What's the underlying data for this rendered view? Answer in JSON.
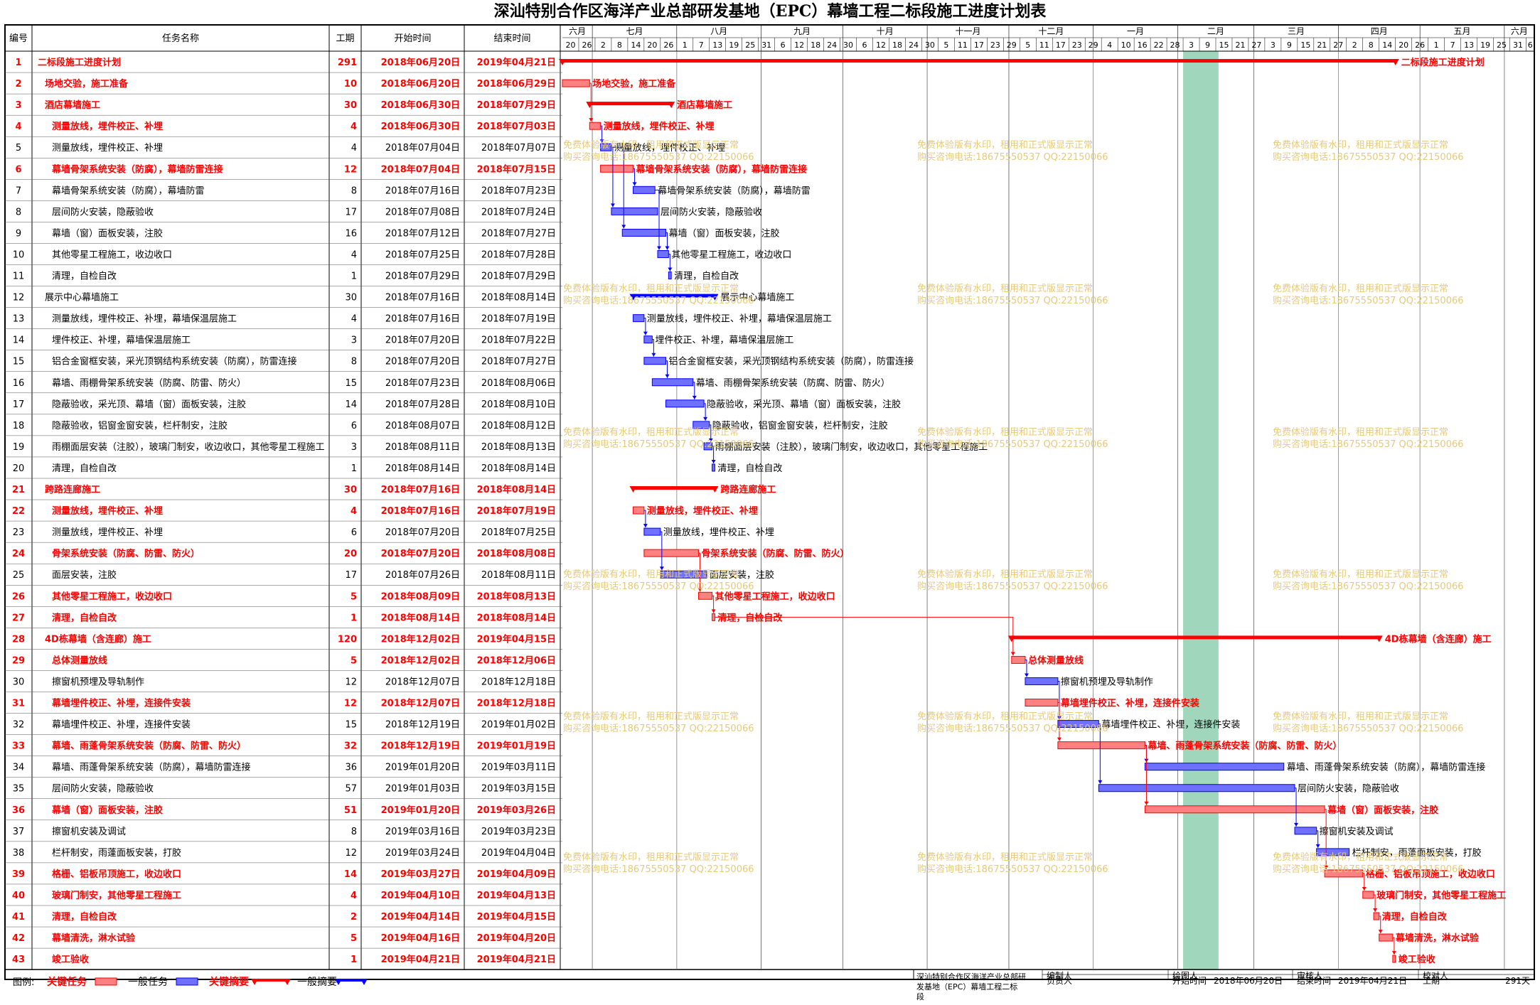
{
  "title": "深汕特别合作区海洋产业总部研发基地（EPC）幕墙工程二标段施工进度计划表",
  "columns": {
    "no": "编号",
    "name": "任务名称",
    "duration": "工期",
    "start": "开始时间",
    "end": "结束时间"
  },
  "months": [
    "六月",
    "七月",
    "八月",
    "九月",
    "十月",
    "十一月",
    "十二月",
    "一月",
    "二月",
    "三月",
    "四月",
    "五月",
    "六月"
  ],
  "day_ticks": [
    "20",
    "26",
    "2",
    "8",
    "14",
    "20",
    "26",
    "1",
    "7",
    "13",
    "19",
    "25",
    "31",
    "6",
    "12",
    "18",
    "24",
    "30",
    "6",
    "12",
    "18",
    "24",
    "30",
    "5",
    "11",
    "17",
    "23",
    "29",
    "5",
    "11",
    "17",
    "23",
    "29",
    "4",
    "10",
    "16",
    "22",
    "28",
    "3",
    "9",
    "15",
    "21",
    "27",
    "3",
    "9",
    "15",
    "21",
    "27",
    "2",
    "8",
    "14",
    "20",
    "26",
    "1",
    "7",
    "13",
    "19",
    "25",
    "31",
    "6",
    "12",
    "18",
    "24",
    "30",
    "5",
    "11",
    "17",
    "23",
    "29",
    "4",
    "10",
    "16",
    "22",
    "28",
    "4",
    "10",
    "16",
    "22",
    "28",
    "3",
    "9",
    "15",
    "21",
    "27",
    "3",
    "9",
    "15",
    "21",
    "27",
    "2",
    "8",
    "14",
    "20",
    "26",
    "1",
    "7",
    "13",
    "19",
    "25",
    "31",
    "6",
    "12",
    "18",
    "24",
    "30",
    "5",
    "11",
    "17",
    "23",
    "29",
    "4",
    "10",
    "16",
    "22",
    "28",
    "3",
    "9",
    "15",
    "21",
    "27",
    "3",
    "9"
  ],
  "chart_data": {
    "type": "gantt",
    "timeline_start": "2018-06-20",
    "timeline_end": "2019-06-12",
    "shaded_period": [
      "2019-02-03",
      "2019-02-16"
    ],
    "tasks": [
      {
        "id": "1",
        "name": "二标段施工进度计划",
        "dur": "291",
        "start": "2018年06月20日",
        "end": "2019年04月21日",
        "kind": "sum",
        "critical": true,
        "s": "2018-06-20",
        "e": "2019-04-21",
        "indent": 0
      },
      {
        "id": "2",
        "name": "场地交验，施工准备",
        "dur": "10",
        "start": "2018年06月20日",
        "end": "2018年06月29日",
        "kind": "task",
        "critical": true,
        "s": "2018-06-20",
        "e": "2018-06-29",
        "indent": 1
      },
      {
        "id": "3",
        "name": "酒店幕墙施工",
        "dur": "30",
        "start": "2018年06月30日",
        "end": "2018年07月29日",
        "kind": "sum",
        "critical": true,
        "s": "2018-06-30",
        "e": "2018-07-29",
        "indent": 1
      },
      {
        "id": "4",
        "name": "测量放线，埋件校正、补埋",
        "dur": "4",
        "start": "2018年06月30日",
        "end": "2018年07月03日",
        "kind": "task",
        "critical": true,
        "s": "2018-06-30",
        "e": "2018-07-03",
        "indent": 2
      },
      {
        "id": "5",
        "name": "测量放线，埋件校正、补埋",
        "dur": "4",
        "start": "2018年07月04日",
        "end": "2018年07月07日",
        "kind": "task",
        "critical": false,
        "s": "2018-07-04",
        "e": "2018-07-07",
        "indent": 2
      },
      {
        "id": "6",
        "name": "幕墙骨架系统安装（防腐），幕墙防雷连接",
        "dur": "12",
        "start": "2018年07月04日",
        "end": "2018年07月15日",
        "kind": "task",
        "critical": true,
        "s": "2018-07-04",
        "e": "2018-07-15",
        "indent": 2
      },
      {
        "id": "7",
        "name": "幕墙骨架系统安装（防腐），幕墙防雷",
        "dur": "8",
        "start": "2018年07月16日",
        "end": "2018年07月23日",
        "kind": "task",
        "critical": false,
        "s": "2018-07-16",
        "e": "2018-07-23",
        "indent": 2
      },
      {
        "id": "8",
        "name": "层间防火安装，隐蔽验收",
        "dur": "17",
        "start": "2018年07月08日",
        "end": "2018年07月24日",
        "kind": "task",
        "critical": false,
        "s": "2018-07-08",
        "e": "2018-07-24",
        "indent": 2
      },
      {
        "id": "9",
        "name": "幕墙（窗）面板安装，注胶",
        "dur": "16",
        "start": "2018年07月12日",
        "end": "2018年07月27日",
        "kind": "task",
        "critical": false,
        "s": "2018-07-12",
        "e": "2018-07-27",
        "indent": 2
      },
      {
        "id": "10",
        "name": "其他零星工程施工，收边收口",
        "dur": "4",
        "start": "2018年07月25日",
        "end": "2018年07月28日",
        "kind": "task",
        "critical": false,
        "s": "2018-07-25",
        "e": "2018-07-28",
        "indent": 2
      },
      {
        "id": "11",
        "name": "清理，自检自改",
        "dur": "1",
        "start": "2018年07月29日",
        "end": "2018年07月29日",
        "kind": "task",
        "critical": false,
        "s": "2018-07-29",
        "e": "2018-07-29",
        "indent": 2
      },
      {
        "id": "12",
        "name": "展示中心幕墙施工",
        "dur": "30",
        "start": "2018年07月16日",
        "end": "2018年08月14日",
        "kind": "sum",
        "critical": false,
        "s": "2018-07-16",
        "e": "2018-08-14",
        "indent": 1
      },
      {
        "id": "13",
        "name": "测量放线，埋件校正、补埋，幕墙保温层施工",
        "dur": "4",
        "start": "2018年07月16日",
        "end": "2018年07月19日",
        "kind": "task",
        "critical": false,
        "s": "2018-07-16",
        "e": "2018-07-19",
        "indent": 2
      },
      {
        "id": "14",
        "name": "埋件校正、补埋，幕墙保温层施工",
        "dur": "3",
        "start": "2018年07月20日",
        "end": "2018年07月22日",
        "kind": "task",
        "critical": false,
        "s": "2018-07-20",
        "e": "2018-07-22",
        "indent": 2
      },
      {
        "id": "15",
        "name": "铝合金窗框安装，采光顶钢结构系统安装（防腐），防雷连接",
        "dur": "8",
        "start": "2018年07月20日",
        "end": "2018年07月27日",
        "kind": "task",
        "critical": false,
        "s": "2018-07-20",
        "e": "2018-07-27",
        "indent": 2
      },
      {
        "id": "16",
        "name": "幕墙、雨棚骨架系统安装（防腐、防雷、防火）",
        "dur": "15",
        "start": "2018年07月23日",
        "end": "2018年08月06日",
        "kind": "task",
        "critical": false,
        "s": "2018-07-23",
        "e": "2018-08-06",
        "indent": 2
      },
      {
        "id": "17",
        "name": "隐蔽验收，采光顶、幕墙（窗）面板安装，注胶",
        "dur": "14",
        "start": "2018年07月28日",
        "end": "2018年08月10日",
        "kind": "task",
        "critical": false,
        "s": "2018-07-28",
        "e": "2018-08-10",
        "indent": 2
      },
      {
        "id": "18",
        "name": "隐蔽验收，铝窗金窗安装，栏杆制安，注胶",
        "dur": "6",
        "start": "2018年08月07日",
        "end": "2018年08月12日",
        "kind": "task",
        "critical": false,
        "s": "2018-08-07",
        "e": "2018-08-12",
        "indent": 2
      },
      {
        "id": "19",
        "name": "雨棚面层安装（注胶），玻璃门制安，收边收口，其他零星工程施工",
        "dur": "3",
        "start": "2018年08月11日",
        "end": "2018年08月13日",
        "kind": "task",
        "critical": false,
        "s": "2018-08-11",
        "e": "2018-08-13",
        "indent": 2
      },
      {
        "id": "20",
        "name": "清理，自检自改",
        "dur": "1",
        "start": "2018年08月14日",
        "end": "2018年08月14日",
        "kind": "task",
        "critical": false,
        "s": "2018-08-14",
        "e": "2018-08-14",
        "indent": 2
      },
      {
        "id": "21",
        "name": "跨路连廊施工",
        "dur": "30",
        "start": "2018年07月16日",
        "end": "2018年08月14日",
        "kind": "sum",
        "critical": true,
        "s": "2018-07-16",
        "e": "2018-08-14",
        "indent": 1
      },
      {
        "id": "22",
        "name": "测量放线，埋件校正、补埋",
        "dur": "4",
        "start": "2018年07月16日",
        "end": "2018年07月19日",
        "kind": "task",
        "critical": true,
        "s": "2018-07-16",
        "e": "2018-07-19",
        "indent": 2
      },
      {
        "id": "23",
        "name": "测量放线，埋件校正、补埋",
        "dur": "6",
        "start": "2018年07月20日",
        "end": "2018年07月25日",
        "kind": "task",
        "critical": false,
        "s": "2018-07-20",
        "e": "2018-07-25",
        "indent": 2
      },
      {
        "id": "24",
        "name": "骨架系统安装（防腐、防雷、防火）",
        "dur": "20",
        "start": "2018年07月20日",
        "end": "2018年08月08日",
        "kind": "task",
        "critical": true,
        "s": "2018-07-20",
        "e": "2018-08-08",
        "indent": 2
      },
      {
        "id": "25",
        "name": "面层安装，注胶",
        "dur": "17",
        "start": "2018年07月26日",
        "end": "2018年08月11日",
        "kind": "task",
        "critical": false,
        "s": "2018-07-26",
        "e": "2018-08-11",
        "indent": 2
      },
      {
        "id": "26",
        "name": "其他零星工程施工，收边收口",
        "dur": "5",
        "start": "2018年08月09日",
        "end": "2018年08月13日",
        "kind": "task",
        "critical": true,
        "s": "2018-08-09",
        "e": "2018-08-13",
        "indent": 2
      },
      {
        "id": "27",
        "name": "清理，自检自改",
        "dur": "1",
        "start": "2018年08月14日",
        "end": "2018年08月14日",
        "kind": "task",
        "critical": true,
        "s": "2018-08-14",
        "e": "2018-08-14",
        "indent": 2
      },
      {
        "id": "28",
        "name": "4D栋幕墙（含连廊）施工",
        "dur": "120",
        "start": "2018年12月02日",
        "end": "2019年04月15日",
        "kind": "sum",
        "critical": true,
        "s": "2018-12-02",
        "e": "2019-04-15",
        "indent": 1
      },
      {
        "id": "29",
        "name": "总体测量放线",
        "dur": "5",
        "start": "2018年12月02日",
        "end": "2018年12月06日",
        "kind": "task",
        "critical": true,
        "s": "2018-12-02",
        "e": "2018-12-06",
        "indent": 2
      },
      {
        "id": "30",
        "name": "擦窗机预埋及导轨制作",
        "dur": "12",
        "start": "2018年12月07日",
        "end": "2018年12月18日",
        "kind": "task",
        "critical": false,
        "s": "2018-12-07",
        "e": "2018-12-18",
        "indent": 2
      },
      {
        "id": "31",
        "name": "幕墙埋件校正、补埋，连接件安装",
        "dur": "12",
        "start": "2018年12月07日",
        "end": "2018年12月18日",
        "kind": "task",
        "critical": true,
        "s": "2018-12-07",
        "e": "2018-12-18",
        "indent": 2
      },
      {
        "id": "32",
        "name": "幕墙埋件校正、补埋，连接件安装",
        "dur": "15",
        "start": "2018年12月19日",
        "end": "2019年01月02日",
        "kind": "task",
        "critical": false,
        "s": "2018-12-19",
        "e": "2019-01-02",
        "indent": 2
      },
      {
        "id": "33",
        "name": "幕墙、雨蓬骨架系统安装（防腐、防雷、防火）",
        "dur": "32",
        "start": "2018年12月19日",
        "end": "2019年01月19日",
        "kind": "task",
        "critical": true,
        "s": "2018-12-19",
        "e": "2019-01-19",
        "indent": 2
      },
      {
        "id": "34",
        "name": "幕墙、雨蓬骨架系统安装（防腐），幕墙防雷连接",
        "dur": "36",
        "start": "2019年01月20日",
        "end": "2019年03月11日",
        "kind": "task",
        "critical": false,
        "s": "2019-01-20",
        "e": "2019-03-11",
        "indent": 2
      },
      {
        "id": "35",
        "name": "层间防火安装，隐蔽验收",
        "dur": "57",
        "start": "2019年01月03日",
        "end": "2019年03月15日",
        "kind": "task",
        "critical": false,
        "s": "2019-01-03",
        "e": "2019-03-15",
        "indent": 2
      },
      {
        "id": "36",
        "name": "幕墙（窗）面板安装，注胶",
        "dur": "51",
        "start": "2019年01月20日",
        "end": "2019年03月26日",
        "kind": "task",
        "critical": true,
        "s": "2019-01-20",
        "e": "2019-03-26",
        "indent": 2
      },
      {
        "id": "37",
        "name": "擦窗机安装及调试",
        "dur": "8",
        "start": "2019年03月16日",
        "end": "2019年03月23日",
        "kind": "task",
        "critical": false,
        "s": "2019-03-16",
        "e": "2019-03-23",
        "indent": 2
      },
      {
        "id": "38",
        "name": "栏杆制安，雨蓬面板安装，打胶",
        "dur": "12",
        "start": "2019年03月24日",
        "end": "2019年04月04日",
        "kind": "task",
        "critical": false,
        "s": "2019-03-24",
        "e": "2019-04-04",
        "indent": 2
      },
      {
        "id": "39",
        "name": "格栅、铝板吊顶施工，收边收口",
        "dur": "14",
        "start": "2019年03月27日",
        "end": "2019年04月09日",
        "kind": "task",
        "critical": true,
        "s": "2019-03-27",
        "e": "2019-04-09",
        "indent": 2
      },
      {
        "id": "40",
        "name": "玻璃门制安，其他零星工程施工",
        "dur": "4",
        "start": "2019年04月10日",
        "end": "2019年04月13日",
        "kind": "task",
        "critical": true,
        "s": "2019-04-10",
        "e": "2019-04-13",
        "indent": 2
      },
      {
        "id": "41",
        "name": "清理，自检自改",
        "dur": "2",
        "start": "2019年04月14日",
        "end": "2019年04月15日",
        "kind": "task",
        "critical": true,
        "s": "2019-04-14",
        "e": "2019-04-15",
        "indent": 2
      },
      {
        "id": "42",
        "name": "幕墙清洗，淋水试验",
        "dur": "5",
        "start": "2019年04月16日",
        "end": "2019年04月20日",
        "kind": "task",
        "critical": true,
        "s": "2019-04-16",
        "e": "2019-04-20",
        "indent": 2
      },
      {
        "id": "43",
        "name": "竣工验收",
        "dur": "1",
        "start": "2019年04月21日",
        "end": "2019年04月21日",
        "kind": "task",
        "critical": true,
        "s": "2019-04-21",
        "e": "2019-04-21",
        "indent": 2
      }
    ],
    "links": [
      [
        "2",
        "4"
      ],
      [
        "4",
        "5"
      ],
      [
        "5",
        "8"
      ],
      [
        "5",
        "9"
      ],
      [
        "6",
        "7"
      ],
      [
        "7",
        "10"
      ],
      [
        "9",
        "10"
      ],
      [
        "10",
        "11"
      ],
      [
        "13",
        "14"
      ],
      [
        "14",
        "15"
      ],
      [
        "15",
        "16"
      ],
      [
        "16",
        "17"
      ],
      [
        "17",
        "18"
      ],
      [
        "18",
        "19"
      ],
      [
        "19",
        "20"
      ],
      [
        "22",
        "23"
      ],
      [
        "23",
        "25"
      ],
      [
        "24",
        "26"
      ],
      [
        "26",
        "27"
      ],
      [
        "27",
        "29"
      ],
      [
        "29",
        "30"
      ],
      [
        "30",
        "32"
      ],
      [
        "31",
        "33"
      ],
      [
        "32",
        "35"
      ],
      [
        "33",
        "34"
      ],
      [
        "33",
        "36"
      ],
      [
        "35",
        "37"
      ],
      [
        "36",
        "39"
      ],
      [
        "37",
        "38"
      ],
      [
        "39",
        "40"
      ],
      [
        "40",
        "41"
      ],
      [
        "41",
        "42"
      ],
      [
        "42",
        "43"
      ]
    ],
    "colors": {
      "critical": "#ff0000",
      "critical_bar": "#ff8080",
      "normal": "#0000ff",
      "normal_bar": "#7070ff",
      "shade": "#9fd6bc",
      "critical_text": "#ff0000",
      "normal_text": "#000000"
    }
  },
  "watermark": {
    "line1": "免费体验版有水印，租用和正式版显示正常",
    "line2": "购买咨询电话:18675550537 QQ:22150066",
    "color": "#e6c97a"
  },
  "legend": {
    "label": "图例:",
    "items": [
      "关键任务",
      "一般任务",
      "关键摘要",
      "一般摘要"
    ]
  },
  "footer": {
    "project": "深汕特别合作区海洋产业总部研发基地（EPC）幕墙工程二标段",
    "labels": [
      "编制人",
      "绘图人",
      "审核人",
      "校对人",
      "负责人",
      "开始时间",
      "结束时间",
      "工期"
    ],
    "start_value": "2018年06月20日",
    "end_value": "2019年04月21日",
    "duration_value": "291天"
  }
}
